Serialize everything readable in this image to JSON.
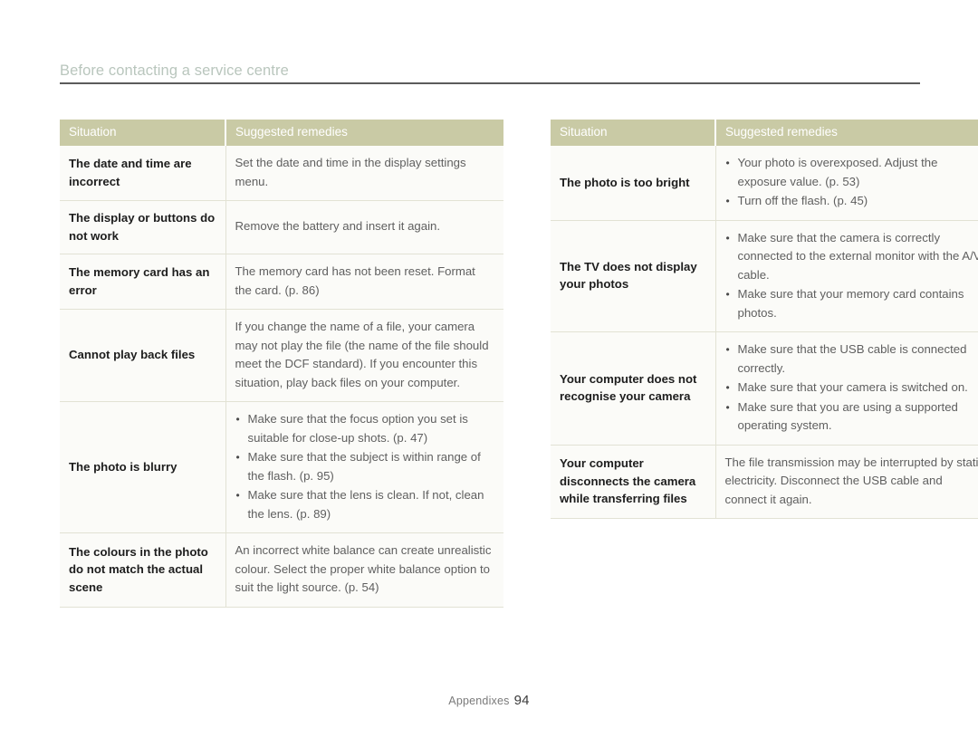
{
  "document": {
    "header_title": "Before contacting a service centre",
    "footer_label": "Appendixes",
    "footer_page_number": "94",
    "colors": {
      "table_header_bg": "#c9caa5",
      "table_header_text": "#ffffff",
      "row_bg": "#fbfbf8",
      "row_border": "#e2e2d4",
      "situation_text": "#1d1d1d",
      "remedy_text": "#5f5f5f",
      "title_text": "#b9c6bd",
      "rule_line": "#5b5b5b"
    }
  },
  "tables": [
    {
      "id": "left-table",
      "columns": [
        "Situation",
        "Suggested remedies"
      ],
      "rows": [
        {
          "situation": "The date and time are incorrect",
          "remedy_type": "paragraph",
          "remedy_text": "Set the date and time in the display settings menu.",
          "remedy_bullets": []
        },
        {
          "situation": "The display or buttons do not work",
          "remedy_type": "paragraph",
          "remedy_text": "Remove the battery and insert it again.",
          "remedy_bullets": []
        },
        {
          "situation": "The memory card has an error",
          "remedy_type": "paragraph",
          "remedy_text": "The memory card has not been reset. Format the card. (p. 86)",
          "remedy_bullets": []
        },
        {
          "situation": "Cannot play back files",
          "remedy_type": "paragraph",
          "remedy_text": "If you change the name of a file, your camera may not play the file (the name of the file should meet the DCF standard). If you encounter this situation, play back files on your computer.",
          "remedy_bullets": []
        },
        {
          "situation": "The photo is blurry",
          "remedy_type": "bullets",
          "remedy_text": "",
          "remedy_bullets": [
            "Make sure that the focus option you set is suitable for close-up shots. (p. 47)",
            "Make sure that the subject is within range of the flash. (p. 95)",
            "Make sure that the lens is clean. If not, clean the lens. (p. 89)"
          ]
        },
        {
          "situation": "The colours in the photo do not match the actual scene",
          "remedy_type": "paragraph",
          "remedy_text": "An incorrect white balance can create unrealistic colour. Select the proper white balance option to suit the light source. (p. 54)",
          "remedy_bullets": []
        }
      ]
    },
    {
      "id": "right-table",
      "columns": [
        "Situation",
        "Suggested remedies"
      ],
      "rows": [
        {
          "situation": "The photo is too bright",
          "remedy_type": "bullets",
          "remedy_text": "",
          "remedy_bullets": [
            "Your photo is overexposed. Adjust the exposure value. (p. 53)",
            "Turn off the flash. (p. 45)"
          ]
        },
        {
          "situation": "The TV does not display your photos",
          "remedy_type": "bullets",
          "remedy_text": "",
          "remedy_bullets": [
            "Make sure that the camera is correctly connected to the external monitor with the A/V cable.",
            "Make sure that your memory card contains photos."
          ]
        },
        {
          "situation": "Your computer does not recognise your camera",
          "remedy_type": "bullets",
          "remedy_text": "",
          "remedy_bullets": [
            "Make sure that the USB cable is connected correctly.",
            "Make sure that your camera is switched on.",
            "Make sure that you are using a supported operating system."
          ]
        },
        {
          "situation": "Your computer disconnects the camera while transferring files",
          "remedy_type": "paragraph",
          "remedy_text": "The file transmission may be interrupted by static electricity. Disconnect the USB cable and connect it again.",
          "remedy_bullets": []
        }
      ]
    }
  ]
}
